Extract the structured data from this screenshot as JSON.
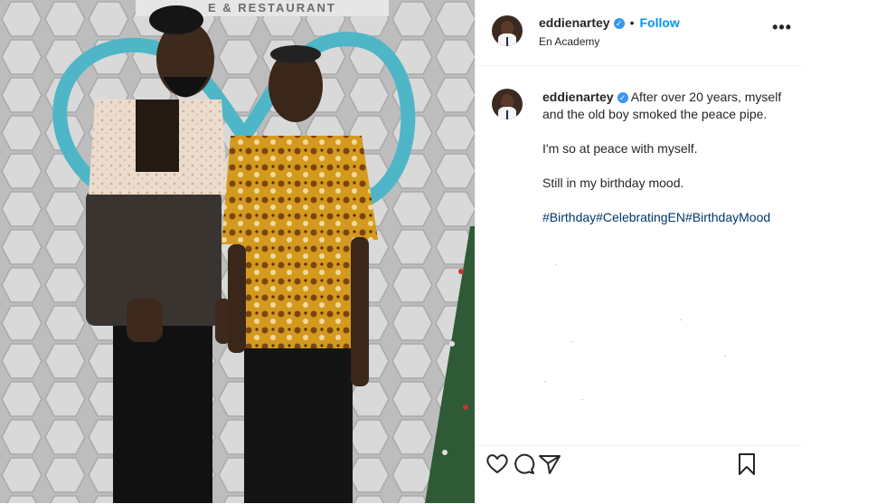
{
  "photo": {
    "sign_text": "E & RESTAURANT"
  },
  "header": {
    "username": "eddienartey",
    "verified_mark": "✓",
    "separator": "•",
    "follow_label": "Follow",
    "subtitle": "En Academy",
    "more_label": "•••"
  },
  "caption": {
    "username": "eddienartey",
    "verified_mark": "✓",
    "line1": "After over 20 years, myself and the old boy smoked the peace pipe.",
    "line2": "I'm so at peace with myself.",
    "line3": "Still in my birthday mood.",
    "hashtags": "#Birthday#CelebratingEN#BirthdayMood"
  },
  "actions": {
    "like_icon": "heart-icon",
    "comment_icon": "comment-icon",
    "share_icon": "share-icon",
    "save_icon": "bookmark-icon"
  },
  "colors": {
    "accent": "#0095f6",
    "verified": "#3897f0",
    "hashtag": "#00376b",
    "text": "#262626"
  }
}
